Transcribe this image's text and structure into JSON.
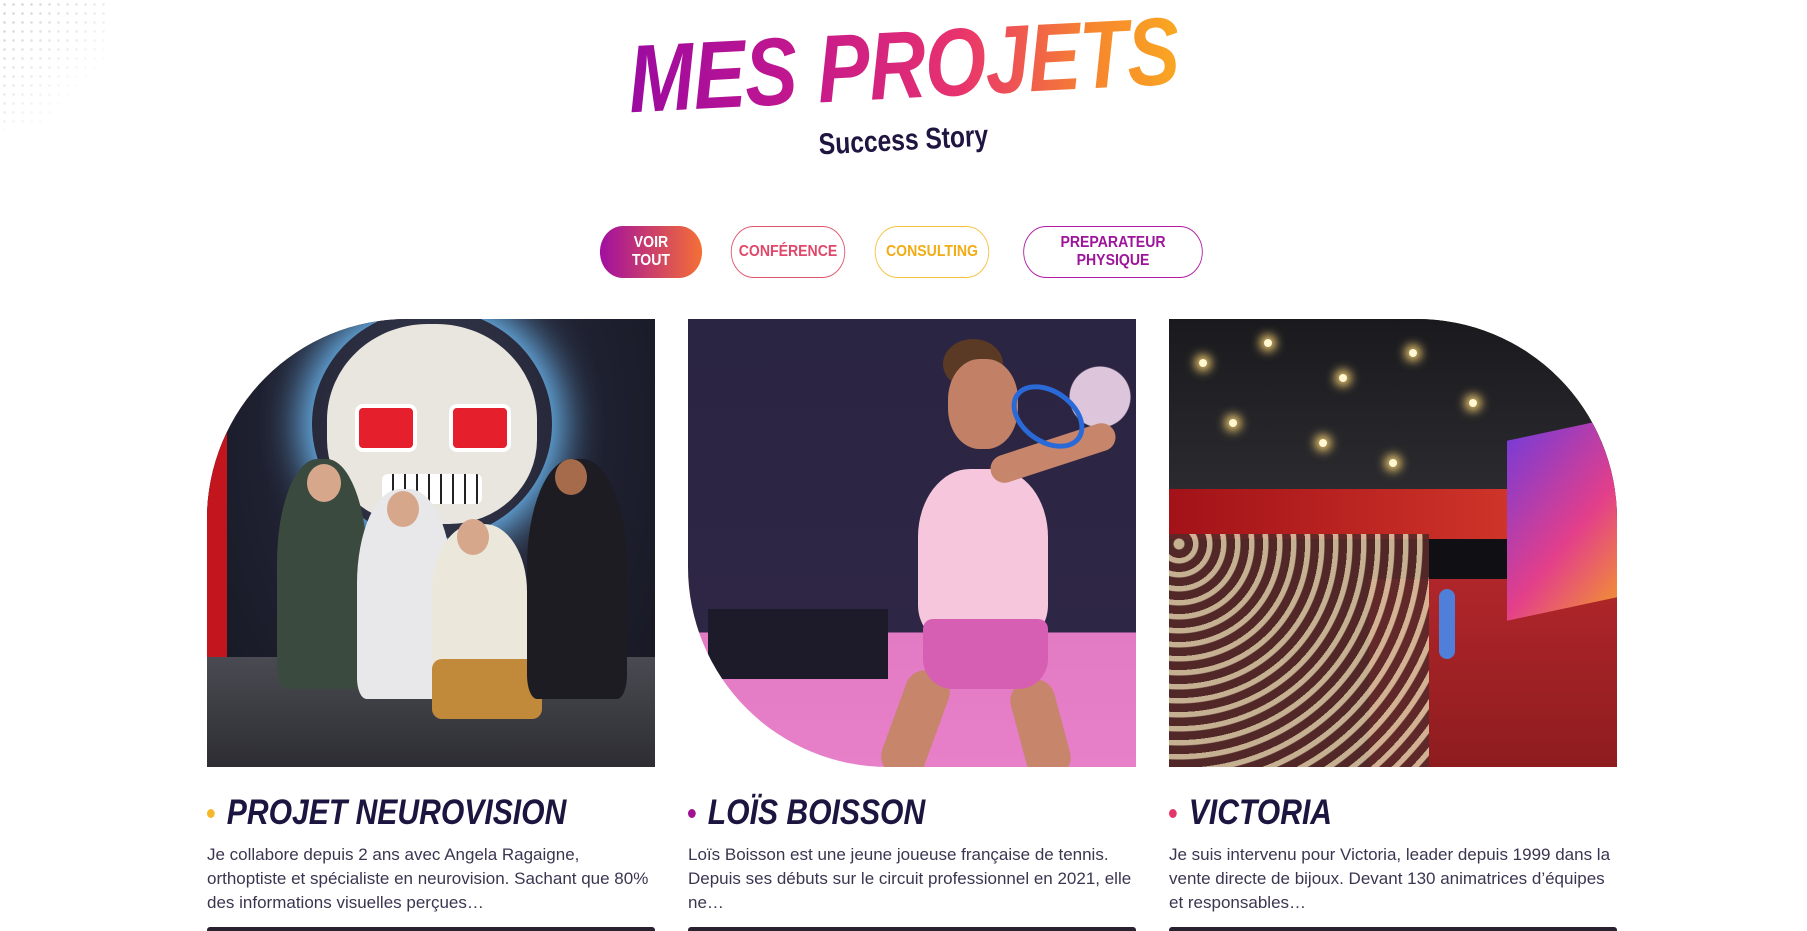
{
  "header": {
    "title": "MES PROJETS",
    "subtitle": "Success Story"
  },
  "filters": [
    {
      "label": "VOIR TOUT",
      "active": true
    },
    {
      "label": "CONFÉRENCE",
      "active": false
    },
    {
      "label": "CONSULTING",
      "active": false
    },
    {
      "label": "PREPARATEUR PHYSIQUE",
      "active": false
    }
  ],
  "colors": {
    "gradient_start": "#9b0aa0",
    "gradient_end": "#f9a722",
    "dark_navy": "#1b1540",
    "bullet_yellow": "#f6b82a",
    "bullet_purple": "#a0128f",
    "bullet_pink": "#e5366a"
  },
  "projects": [
    {
      "title": "PROJET NEUROVISION",
      "description": "Je collabore depuis 2 ans avec Angela Ragaigne, orthoptiste et spécialiste en neurovision. Sachant que 80% des informations visuelles perçues…"
    },
    {
      "title": "LOÏS BOISSON",
      "description": "Loïs Boisson est une jeune joueuse française de tennis. Depuis ses débuts sur le circuit professionnel en 2021, elle ne…"
    },
    {
      "title": "VICTORIA",
      "description": "Je suis intervenu pour Victoria, leader depuis 1999 dans la vente directe de bijoux. Devant 130 animatrices d’équipes et responsables…"
    }
  ]
}
